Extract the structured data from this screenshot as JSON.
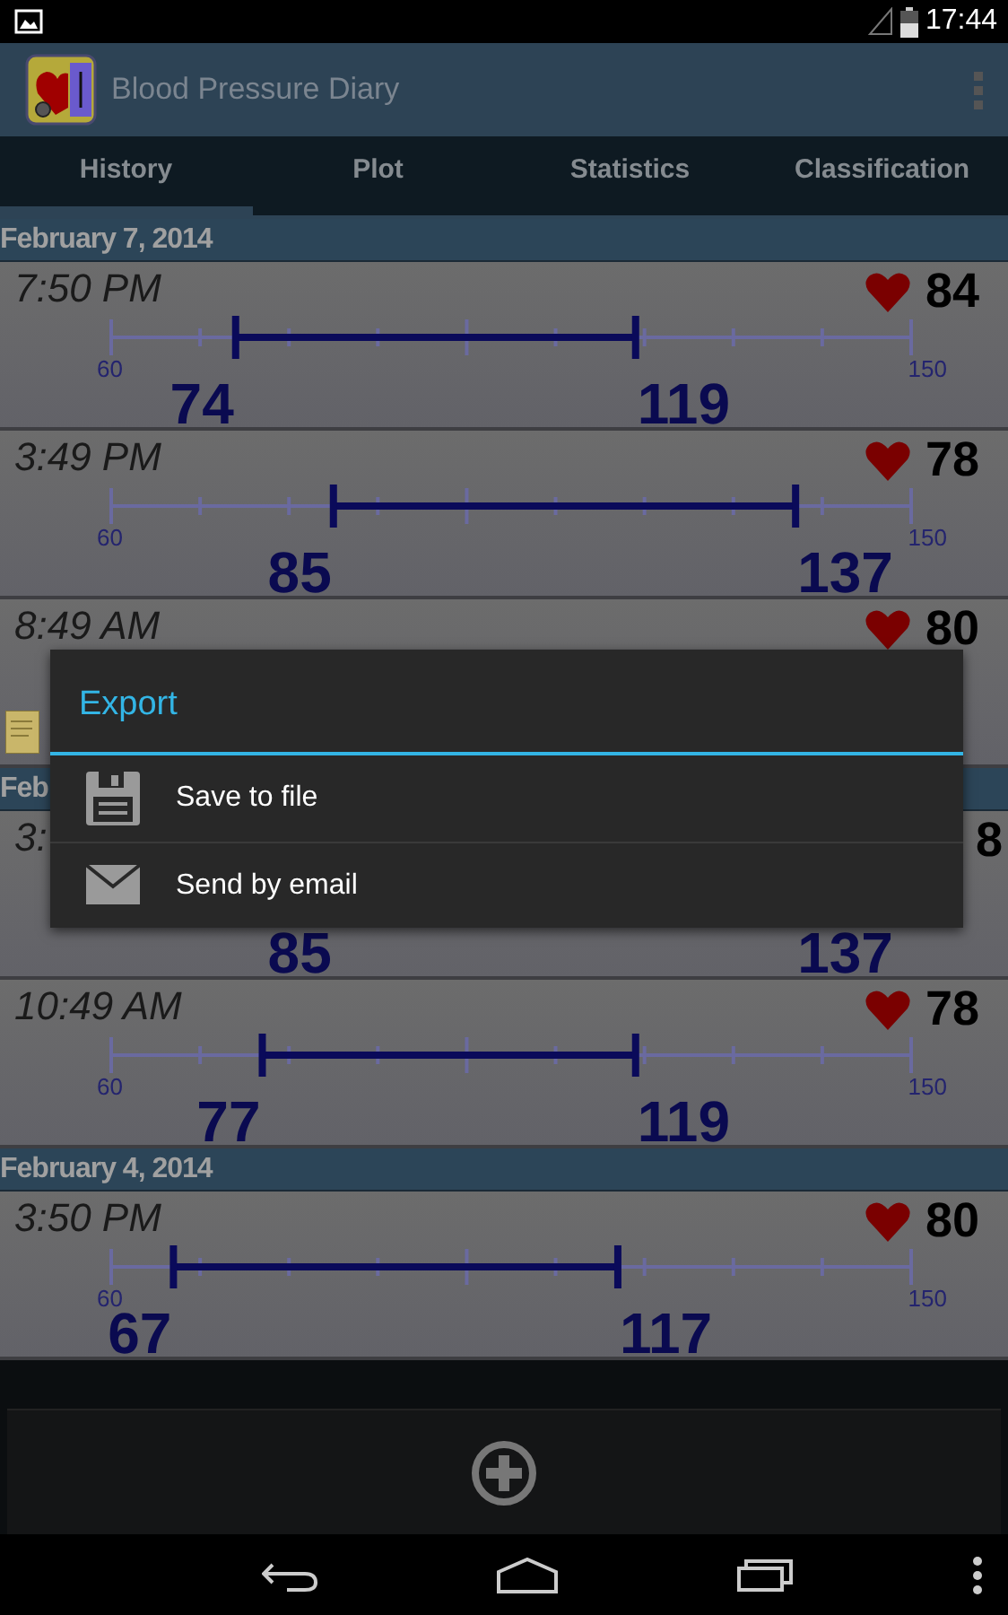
{
  "status_bar": {
    "time": "17:44"
  },
  "app_bar": {
    "title": "Blood Pressure Diary"
  },
  "tabs": [
    {
      "label": "History",
      "selected": true
    },
    {
      "label": "Plot",
      "selected": false
    },
    {
      "label": "Statistics",
      "selected": false
    },
    {
      "label": "Classification",
      "selected": false
    }
  ],
  "history": [
    {
      "date": "February 7, 2014",
      "entries": [
        {
          "time": "7:50 PM",
          "heart": true,
          "pulse": "84",
          "note": false,
          "scale_min": "60",
          "scale_max": "150",
          "low": "74",
          "high": "119"
        },
        {
          "time": "3:49 PM",
          "heart": true,
          "pulse": "78",
          "note": false,
          "scale_min": "60",
          "scale_max": "150",
          "low": "85",
          "high": "137"
        },
        {
          "time": "8:49 AM",
          "heart": true,
          "pulse": "80",
          "note": true
        }
      ]
    },
    {
      "date": "Feb",
      "entries": [
        {
          "time": "3:",
          "heart": false,
          "pulse": "8",
          "note": false,
          "low": "85",
          "high": "137"
        },
        {
          "time": "10:49 AM",
          "heart": true,
          "pulse": "78",
          "note": false,
          "scale_min": "60",
          "scale_max": "150",
          "low": "77",
          "high": "119"
        }
      ]
    },
    {
      "date": "February 4, 2014",
      "entries": [
        {
          "time": "3:50 PM",
          "heart": true,
          "pulse": "80",
          "note": false,
          "scale_min": "60",
          "scale_max": "150",
          "low": "67",
          "high": "117"
        }
      ]
    }
  ],
  "dialog": {
    "title": "Export",
    "items": [
      {
        "kind": "file",
        "label": "Save to file"
      },
      {
        "kind": "email",
        "label": "Send by email"
      }
    ]
  }
}
